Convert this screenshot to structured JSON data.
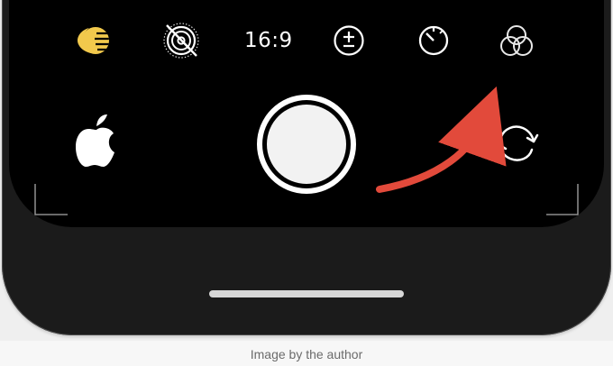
{
  "camera": {
    "top_controls": {
      "night_mode_icon": "moon-icon",
      "live_photo_off_icon": "live-photo-off-icon",
      "aspect_ratio_label": "16:9",
      "exposure_icon": "exposure-icon",
      "timer_icon": "timer-icon",
      "filters_icon": "filters-icon"
    },
    "bottom_controls": {
      "thumbnail_icon": "apple-logo-icon",
      "shutter_icon": "shutter-button",
      "flip_camera_icon": "flip-camera-icon"
    },
    "annotation": {
      "arrow_color": "#e24a3b"
    }
  },
  "caption": "Image by the author",
  "colors": {
    "background": "#000000",
    "accent_yellow": "#f2c94c",
    "arrow": "#e24a3b",
    "text_white": "#ffffff"
  }
}
